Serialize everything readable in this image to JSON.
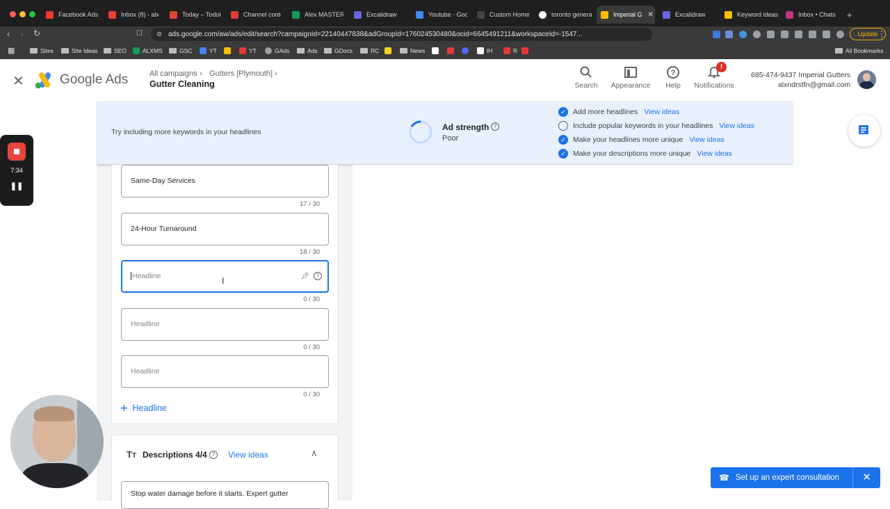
{
  "browser": {
    "tabs": [
      {
        "label": "Facebook Ads",
        "color": "#e53935"
      },
      {
        "label": "Inbox (8) - alx",
        "color": "#ea4335"
      },
      {
        "label": "Today – Todoist",
        "color": "#e44332"
      },
      {
        "label": "Channel conte",
        "color": "#e53935"
      },
      {
        "label": "Alex MASTER",
        "color": "#0f9d58"
      },
      {
        "label": "Excalidraw",
        "color": "#6965db"
      },
      {
        "label": "Youtube - Goo",
        "color": "#4285f4"
      },
      {
        "label": "Custom Home",
        "color": "#444444"
      },
      {
        "label": "toronto genera",
        "color": "#ffffff"
      },
      {
        "label": "Imperial G",
        "color": "#fbbc04"
      },
      {
        "label": "Excalidraw",
        "color": "#6965db"
      },
      {
        "label": "Keyword ideas",
        "color": "#fbbc04"
      },
      {
        "label": "Inbox • Chats",
        "color": "#c13584"
      }
    ],
    "new_tab": "+",
    "close_tab": "✕",
    "url": "ads.google.com/aw/ads/edit/search?campaignId=22140447838&adGroupId=176024530480&ocid=6645491211&workspaceId=-1547...",
    "update_label": "Update",
    "bookmarks": [
      {
        "label": "Sites",
        "kind": "folder"
      },
      {
        "label": "Site Ideas",
        "kind": "folder"
      },
      {
        "label": "SEO",
        "kind": "folder"
      },
      {
        "label": "ALXMS",
        "kind": "sheet"
      },
      {
        "label": "GSC",
        "kind": "folder"
      },
      {
        "label": "YT",
        "kind": "doc"
      },
      {
        "label": "YT",
        "kind": "youtube"
      },
      {
        "label": "GAds",
        "kind": "gads"
      },
      {
        "label": "Ads",
        "kind": "folder"
      },
      {
        "label": "GDocs",
        "kind": "folder"
      },
      {
        "label": "RC",
        "kind": "folder"
      },
      {
        "label": "News",
        "kind": "folder"
      },
      {
        "label": "IH",
        "kind": "ih"
      },
      {
        "label": "R",
        "kind": "r"
      }
    ],
    "all_bookmarks": "All Bookmarks"
  },
  "header": {
    "brand": "Google Ads",
    "breadcrumb_1": "All campaigns",
    "breadcrumb_2": "Gutters [Plymouth]",
    "title": "Gutter Cleaning",
    "nav": {
      "search": "Search",
      "appearance": "Appearance",
      "help": "Help",
      "notifications": "Notifications",
      "notification_badge": "!"
    },
    "account_line_1": "685-474-9437 Imperial Gutters",
    "account_line_2": "alxndrstfn@gmail.com"
  },
  "ad_strength": {
    "tip": "Try including more keywords in your headlines",
    "label": "Ad strength",
    "value": "Poor",
    "help": "?",
    "checklist": [
      {
        "text": "Add more headlines",
        "done": true,
        "link": "View ideas"
      },
      {
        "text": "Include popular keywords in your headlines",
        "done": false,
        "link": "View ideas"
      },
      {
        "text": "Make your headlines more unique",
        "done": true,
        "link": "View ideas"
      },
      {
        "text": "Make your descriptions more unique",
        "done": true,
        "link": "View ideas"
      }
    ]
  },
  "headlines": {
    "fields": [
      {
        "value": "Same-Day Services",
        "counter": "17 / 30"
      },
      {
        "value": "24-Hour Turnaround",
        "counter": "18 / 30"
      },
      {
        "value": "",
        "placeholder": "Headline",
        "counter": "0 / 30"
      },
      {
        "value": "",
        "placeholder": "Headline",
        "counter": "0 / 30"
      },
      {
        "value": "",
        "placeholder": "Headline",
        "counter": "0 / 30"
      }
    ],
    "add_label": "Headline"
  },
  "descriptions": {
    "title": "Descriptions 4/4",
    "view_ideas": "View ideas",
    "first_value": "Stop water damage before it starts. Expert gutter"
  },
  "consultation": {
    "label": "Set up an expert consultation"
  },
  "recorder": {
    "time": "7:34"
  },
  "colors": {
    "accent": "#1a73e8",
    "strength_bg": "#e8f0fe",
    "page_bg": "#f1f3f4"
  }
}
